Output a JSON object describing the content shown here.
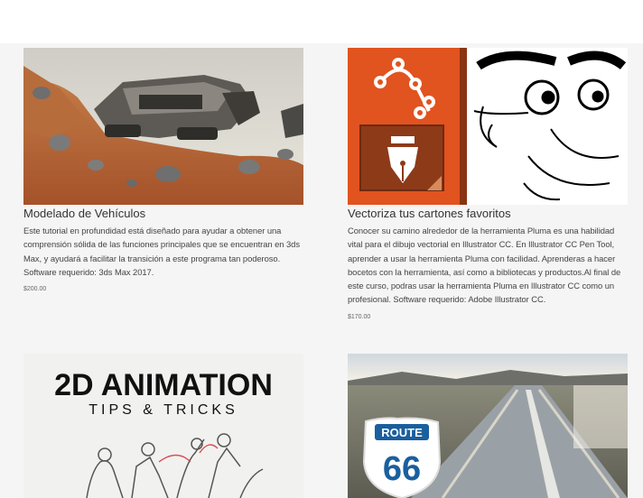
{
  "courses": [
    {
      "title": "Modelado de Vehículos",
      "description": "Este tutorial en profundidad está diseñado para ayudar a obtener una comprensión sólida de las funciones principales que se encuentran en 3ds Max, y ayudará a facilitar la transición a este programa tan poderoso. Software requerido: 3ds Max 2017.",
      "price": "$200.00"
    },
    {
      "title": "Vectoriza tus cartones favoritos",
      "description": "Conocer su camino alrededor de la herramienta Pluma es una habilidad vital para el dibujo vectorial en Illustrator CC. En Illustrator CC Pen Tool, aprender a usar la herramienta Pluma con facilidad. Aprenderas a hacer bocetos con la herramienta, así como a bibliotecas y productos.Al final de este curso, podras usar la herramienta Pluma en Illustrator CC como un profesional. Software requerido: Adobe Illustrator CC.",
      "price": "$170.00"
    },
    {
      "thumb_text": [
        "2D ANIMATION",
        "TIPS & TRICKS"
      ]
    },
    {
      "thumb_text": [
        "ROUTE",
        "66"
      ]
    }
  ],
  "colors": {
    "illustrator_orange": "#e1531f",
    "route_blue": "#1a5f9e"
  }
}
